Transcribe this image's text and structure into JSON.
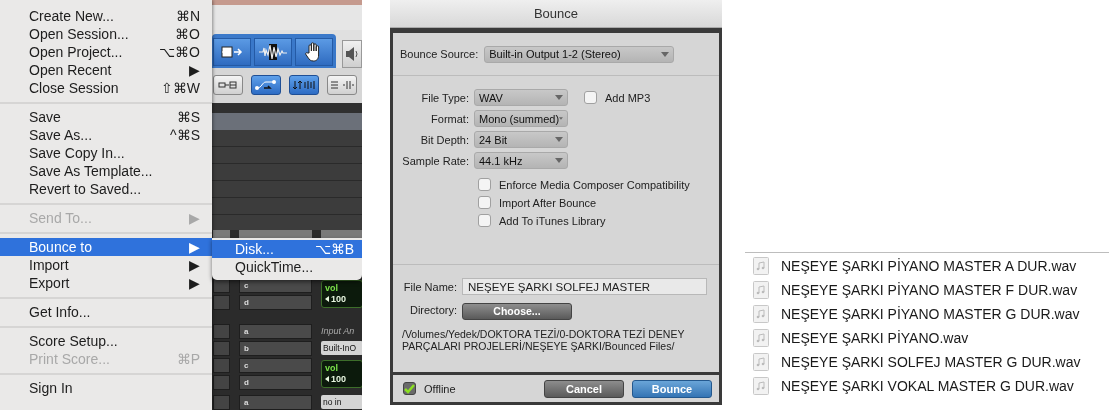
{
  "file_menu": {
    "items": [
      {
        "kind": "item",
        "label": "Create New...",
        "shortcut": "⌘N",
        "disabled": false,
        "selected": false
      },
      {
        "kind": "item",
        "label": "Open Session...",
        "shortcut": "⌘O",
        "disabled": false,
        "selected": false
      },
      {
        "kind": "item",
        "label": "Open Project...",
        "shortcut": "⌥⌘O",
        "disabled": false,
        "selected": false
      },
      {
        "kind": "item",
        "label": "Open Recent",
        "shortcut": "▶",
        "disabled": false,
        "selected": false
      },
      {
        "kind": "item",
        "label": "Close Session",
        "shortcut": "⇧⌘W",
        "disabled": false,
        "selected": false
      },
      {
        "kind": "separator"
      },
      {
        "kind": "item",
        "label": "Save",
        "shortcut": "⌘S",
        "disabled": false,
        "selected": false
      },
      {
        "kind": "item",
        "label": "Save As...",
        "shortcut": "^⌘S",
        "disabled": false,
        "selected": false
      },
      {
        "kind": "item",
        "label": "Save Copy In...",
        "disabled": false,
        "selected": false
      },
      {
        "kind": "item",
        "label": "Save As Template...",
        "disabled": false,
        "selected": false
      },
      {
        "kind": "item",
        "label": "Revert to Saved...",
        "disabled": false,
        "selected": false
      },
      {
        "kind": "separator"
      },
      {
        "kind": "item",
        "label": "Send To...",
        "shortcut": "▶",
        "disabled": true,
        "selected": false
      },
      {
        "kind": "separator"
      },
      {
        "kind": "item",
        "label": "Bounce to",
        "shortcut": "▶",
        "disabled": false,
        "selected": true
      },
      {
        "kind": "item",
        "label": "Import",
        "shortcut": "▶",
        "disabled": false,
        "selected": false
      },
      {
        "kind": "item",
        "label": "Export",
        "shortcut": "▶",
        "disabled": false,
        "selected": false
      },
      {
        "kind": "separator"
      },
      {
        "kind": "item",
        "label": "Get Info...",
        "disabled": false,
        "selected": false
      },
      {
        "kind": "separator"
      },
      {
        "kind": "item",
        "label": "Score Setup...",
        "disabled": false,
        "selected": false
      },
      {
        "kind": "item",
        "label": "Print Score...",
        "shortcut": "⌘P",
        "disabled": true,
        "selected": false
      },
      {
        "kind": "separator"
      },
      {
        "kind": "item",
        "label": "Sign In",
        "disabled": false,
        "selected": false
      }
    ]
  },
  "submenu": {
    "items": [
      {
        "label": "Disk...",
        "shortcut": "⌥⌘B",
        "selected": true
      },
      {
        "label": "QuickTime...",
        "selected": false
      }
    ]
  },
  "mixer": {
    "tools": [
      {
        "kind": "trim"
      },
      {
        "kind": "waveform"
      },
      {
        "kind": "grabber"
      },
      {
        "kind": "speaker"
      }
    ],
    "toggles": [
      {
        "kind": "insert",
        "on": false
      },
      {
        "kind": "link",
        "on": true
      },
      {
        "kind": "nudge",
        "on": true
      },
      {
        "kind": "spacing",
        "on": false
      }
    ],
    "groups": [
      {
        "kind": "meter",
        "sends": [
          "c",
          "d"
        ],
        "label": "vol",
        "value": "100"
      },
      {
        "kind": "io",
        "sends": [
          "a",
          "b"
        ],
        "label": "Input An",
        "value": "Built-InO"
      },
      {
        "kind": "meter",
        "sends": [
          "c",
          "d"
        ],
        "label": "vol",
        "value": "100"
      },
      {
        "kind": "button",
        "sends": [
          "a"
        ],
        "value": "no in"
      }
    ]
  },
  "bounce_dialog": {
    "title": "Bounce",
    "bounce_source": {
      "label": "Bounce Source:",
      "value": "Built-in Output 1-2 (Stereo)"
    },
    "settings": [
      {
        "label": "File Type:",
        "value": "WAV"
      },
      {
        "label": "Format:",
        "value": "Mono (summed)"
      },
      {
        "label": "Bit Depth:",
        "value": "24 Bit"
      },
      {
        "label": "Sample Rate:",
        "value": "44.1 kHz"
      }
    ],
    "add_mp3": {
      "label": "Add MP3",
      "checked": false
    },
    "options": [
      {
        "label": "Enforce Media Composer Compatibility",
        "checked": false
      },
      {
        "label": "Import After Bounce",
        "checked": false
      },
      {
        "label": "Add To iTunes Library",
        "checked": false
      }
    ],
    "file_name": {
      "label": "File Name:",
      "value": "NEŞEYE ŞARKI SOLFEJ MASTER"
    },
    "directory": {
      "label": "Directory:",
      "button": "Choose..."
    },
    "path": "/Volumes/Yedek/DOKTORA TEZİ/0-DOKTORA TEZİ DENEY PARÇALARI PROJELERİ/NEŞEYE ŞARKI/Bounced Files/",
    "offline": {
      "label": "Offline",
      "checked": true
    },
    "buttons": [
      {
        "label": "Cancel",
        "kind": "secondary"
      },
      {
        "label": "Bounce",
        "kind": "primary"
      }
    ]
  },
  "file_list": {
    "files": [
      "NEŞEYE ŞARKI PİYANO MASTER A DUR.wav",
      "NEŞEYE ŞARKI PİYANO MASTER F DUR.wav",
      "NEŞEYE ŞARKI PİYANO MASTER G DUR.wav",
      "NEŞEYE ŞARKI PİYANO.wav",
      "NEŞEYE ŞARKI SOLFEJ MASTER G DUR.wav",
      "NEŞEYE ŞARKI VOKAL MASTER G DUR.wav"
    ]
  }
}
